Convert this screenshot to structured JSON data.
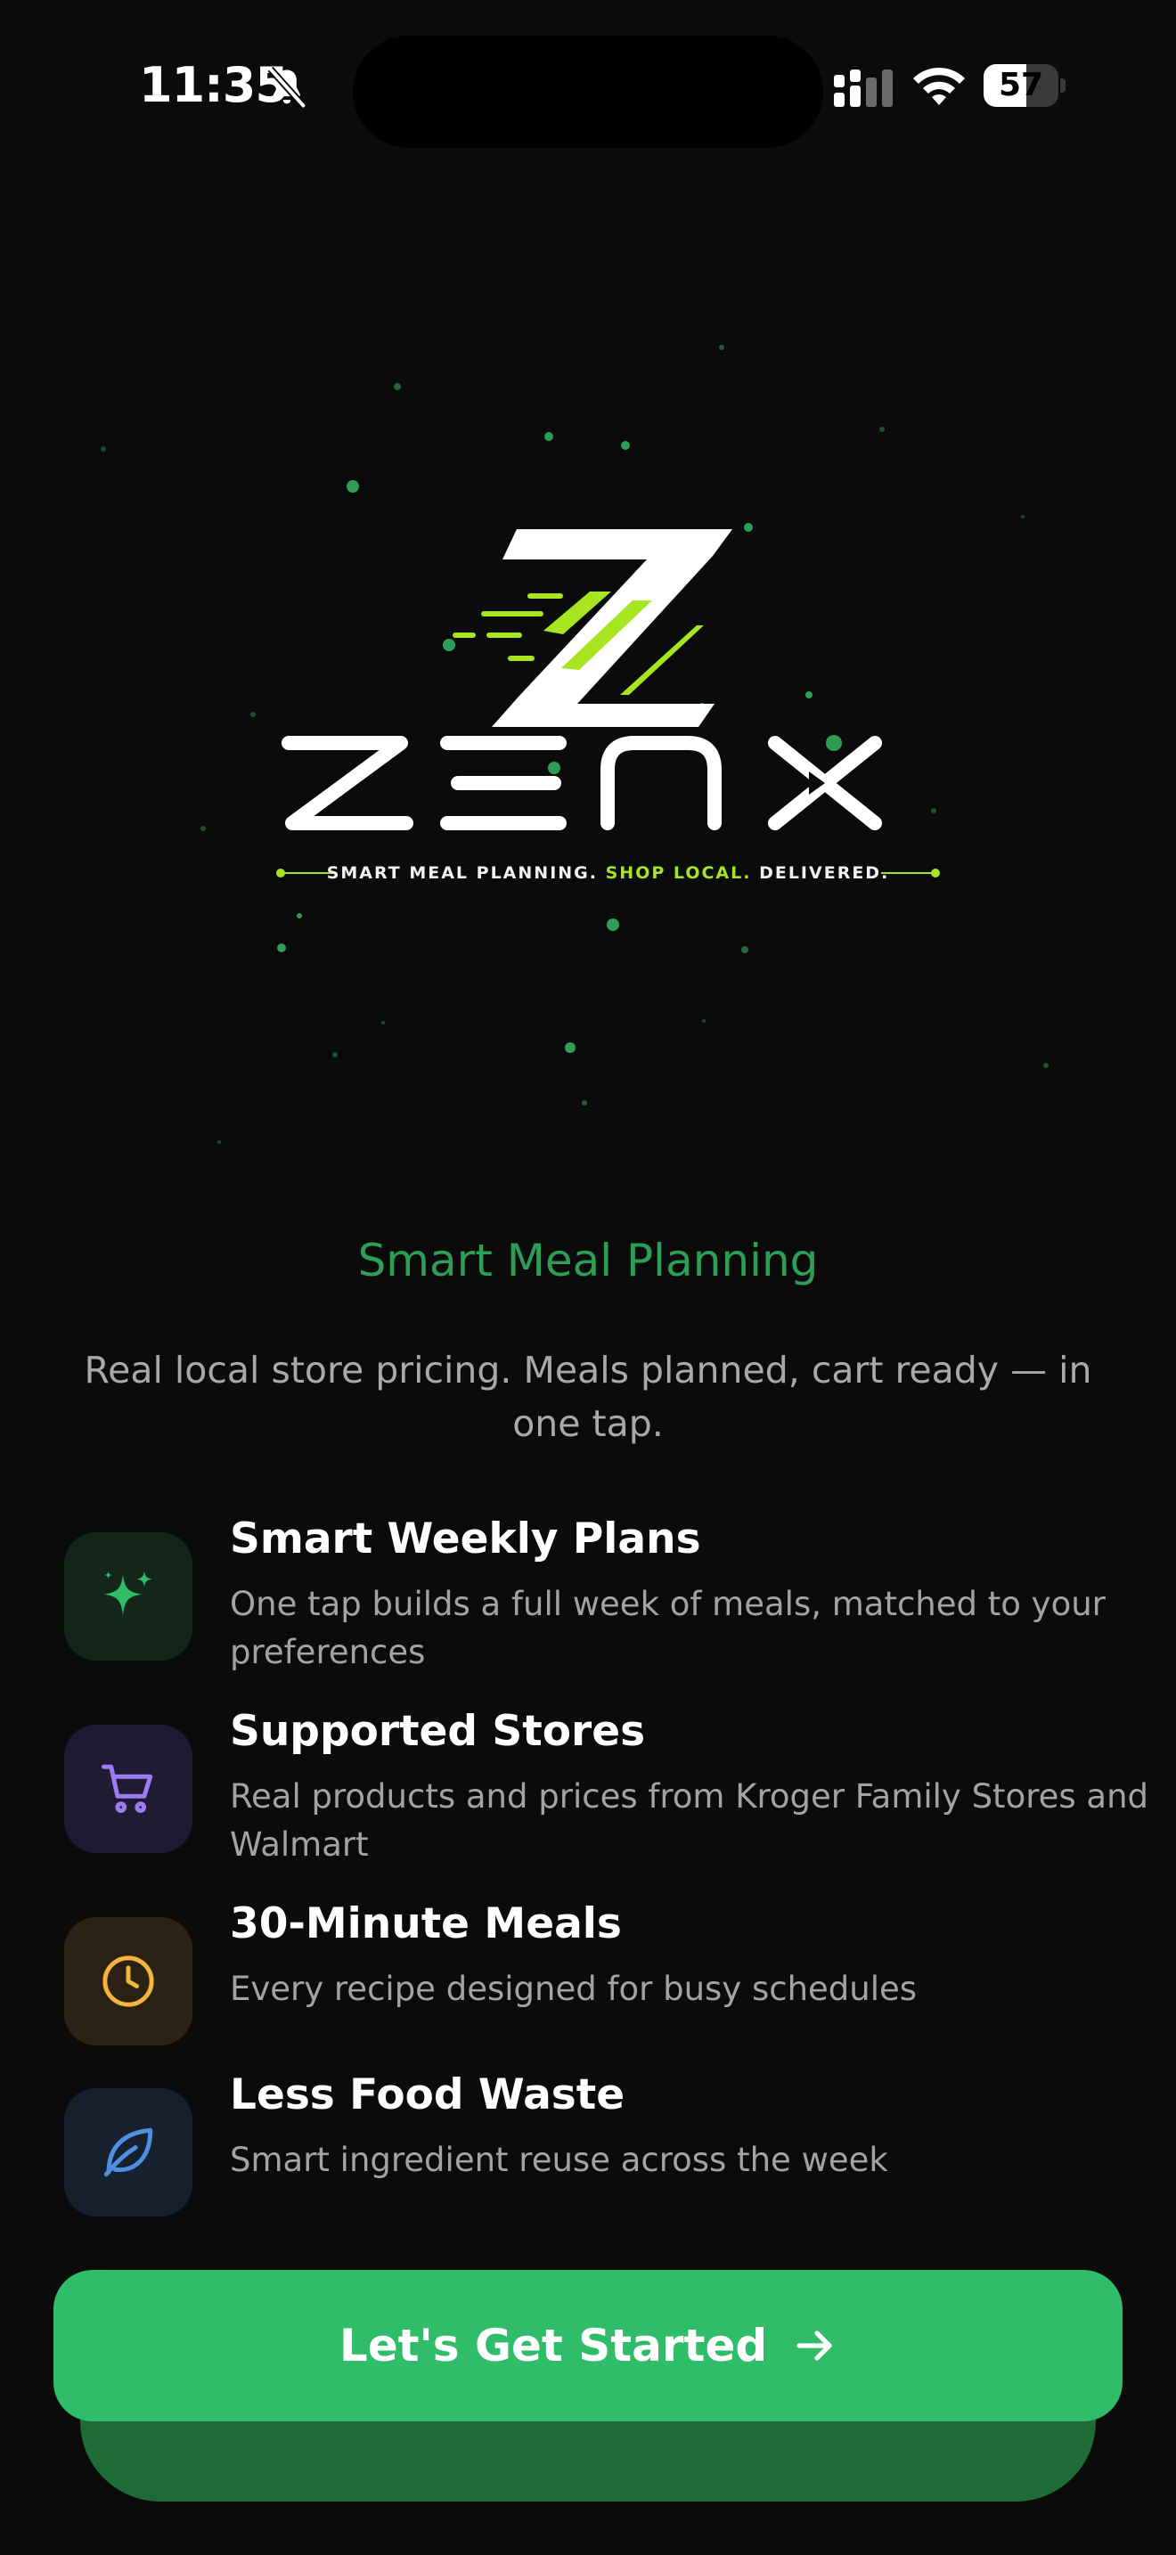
{
  "status_bar": {
    "time": "11:35",
    "battery_percent": "57",
    "battery_level": 0.57,
    "icons": [
      "bell-slash-icon",
      "signal-icon",
      "wifi-icon",
      "battery-icon"
    ]
  },
  "brand": {
    "tagline_part1": "SMART MEAL PLANNING.",
    "tagline_part2": "SHOP LOCAL.",
    "tagline_part3": "DELIVERED.",
    "colors": {
      "accent_lime": "#a6e51f",
      "green": "#2fbd69",
      "dark_green": "#1e6b38",
      "background": "#0b0b0b"
    }
  },
  "onboarding": {
    "headline": "Smart Meal Planning",
    "subtitle": "Real local store pricing. Meals planned, cart ready — in one tap."
  },
  "features": [
    {
      "title": "Smart Weekly Plans",
      "description": "One tap builds a full week of meals, matched to your preferences",
      "icon": "sparkles-icon",
      "icon_color": "#2fbd69",
      "tile_color": "#12271a"
    },
    {
      "title": "Supported Stores",
      "description": "Real products and prices from Kroger Family Stores and Walmart",
      "icon": "shopping-cart-icon",
      "icon_color": "#9b7cf5",
      "tile_color": "#1f1b33"
    },
    {
      "title": "30-Minute Meals",
      "description": "Every recipe designed for busy schedules",
      "icon": "clock-icon",
      "icon_color": "#f2b63a",
      "tile_color": "#2b2214"
    },
    {
      "title": "Less Food Waste",
      "description": "Smart ingredient reuse across the week",
      "icon": "leaf-icon",
      "icon_color": "#4f8fe0",
      "tile_color": "#16202e"
    }
  ],
  "cta": {
    "label": "Let's Get Started",
    "icon": "arrow-right-icon"
  }
}
